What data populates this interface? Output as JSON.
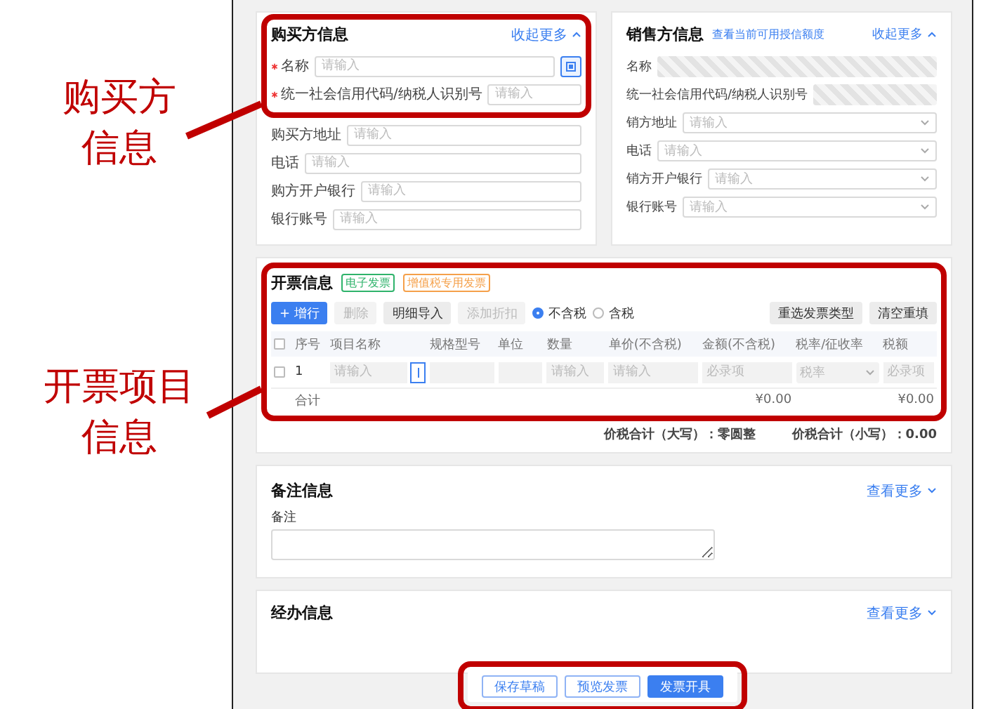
{
  "annotations": [
    {
      "lines": [
        "购买方",
        "信息"
      ]
    },
    {
      "lines": [
        "开票项目",
        "信息"
      ]
    }
  ],
  "buyer": {
    "title": "购买方信息",
    "toggle": {
      "label": "收起更多",
      "expanded": true
    },
    "fields": [
      {
        "label": "名称",
        "required": true,
        "placeholder": "请输入",
        "kind": "lookup"
      },
      {
        "label": "统一社会信用代码/纳税人识别号",
        "required": true,
        "placeholder": "请输入",
        "kind": "input"
      },
      {
        "label": "购买方地址",
        "required": false,
        "placeholder": "请输入",
        "kind": "input"
      },
      {
        "label": "电话",
        "required": false,
        "placeholder": "请输入",
        "kind": "input"
      },
      {
        "label": "购方开户银行",
        "required": false,
        "placeholder": "请输入",
        "kind": "input"
      },
      {
        "label": "银行账号",
        "required": false,
        "placeholder": "请输入",
        "kind": "input"
      }
    ]
  },
  "seller": {
    "title": "销售方信息",
    "link": "查看当前可用授信额度",
    "toggle": {
      "label": "收起更多",
      "expanded": true
    },
    "fields": [
      {
        "label": "名称",
        "kind": "masked"
      },
      {
        "label": "统一社会信用代码/纳税人识别号",
        "kind": "masked"
      },
      {
        "label": "销方地址",
        "placeholder": "请输入",
        "kind": "select"
      },
      {
        "label": "电话",
        "placeholder": "请输入",
        "kind": "select"
      },
      {
        "label": "销方开户银行",
        "placeholder": "请输入",
        "kind": "select"
      },
      {
        "label": "银行账号",
        "placeholder": "请输入",
        "kind": "select"
      }
    ]
  },
  "invoice": {
    "title": "开票信息",
    "tags": [
      {
        "text": "电子发票",
        "color": "#2fb36b"
      },
      {
        "text": "增值税专用发票",
        "color": "#f5a04a"
      }
    ],
    "toolbar": [
      {
        "label": "+ 增行",
        "kind": "primary"
      },
      {
        "label": "删除",
        "kind": "disabled"
      },
      {
        "label": "明细导入",
        "kind": "default"
      },
      {
        "label": "添加折扣",
        "kind": "disabled"
      }
    ],
    "radios": [
      {
        "label": "不含税",
        "selected": true
      },
      {
        "label": "含税",
        "selected": false
      }
    ],
    "actions": [
      {
        "label": "重选发票类型"
      },
      {
        "label": "清空重填"
      }
    ],
    "header_checkbox": {
      "checked": false
    },
    "columns": [
      "序号",
      "项目名称",
      "规格型号",
      "单位",
      "数量",
      "单价(不含税)",
      "金额(不含税)",
      "税率/征收率",
      "税额"
    ],
    "rows": [
      {
        "checked": false,
        "cells": [
          {
            "kind": "index",
            "text": "1"
          },
          {
            "kind": "input",
            "placeholder": "请输入"
          },
          {
            "kind": "empty"
          },
          {
            "kind": "empty"
          },
          {
            "kind": "input",
            "placeholder": "请输入"
          },
          {
            "kind": "input",
            "placeholder": "请输入"
          },
          {
            "kind": "input",
            "placeholder": "必录项"
          },
          {
            "kind": "select",
            "placeholder": "税率"
          },
          {
            "kind": "input",
            "placeholder": "必录项"
          }
        ]
      }
    ],
    "total_label": "合计",
    "total_amount": "¥0.00",
    "total_tax": "¥0.00",
    "sum_upper": "价税合计（大写）：零圆整",
    "sum_lower": "价税合计（小写）：0.00"
  },
  "remarks": {
    "title": "备注信息",
    "toggle": {
      "label": "查看更多",
      "expanded": false
    },
    "label": "备注"
  },
  "handler": {
    "title": "经办信息",
    "toggle": {
      "label": "查看更多",
      "expanded": false
    }
  },
  "footer": [
    {
      "label": "保存草稿",
      "kind": "outline"
    },
    {
      "label": "预览发票",
      "kind": "outline"
    },
    {
      "label": "发票开具",
      "kind": "primary"
    }
  ]
}
